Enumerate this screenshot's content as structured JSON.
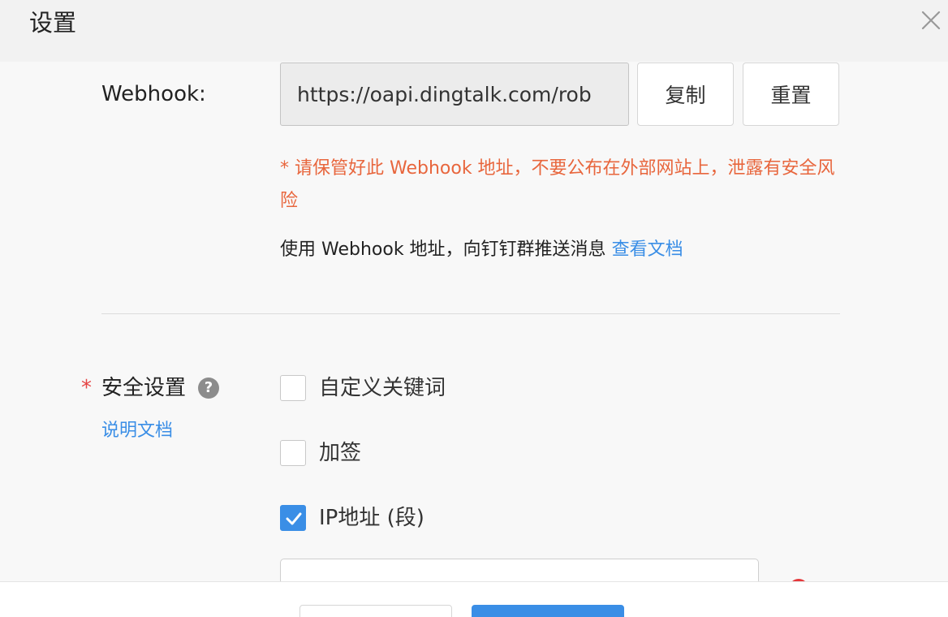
{
  "dialog": {
    "title": "设置"
  },
  "webhook": {
    "label": "Webhook:",
    "value": "https://oapi.dingtalk.com/rob",
    "copy_label": "复制",
    "reset_label": "重置",
    "warning": "* 请保管好此 Webhook 地址，不要公布在外部网站上，泄露有安全风险",
    "usage_text": "使用 Webhook 地址，向钉钉群推送消息",
    "usage_link": "查看文档"
  },
  "security": {
    "required_mark": "*",
    "label": "安全设置",
    "help_glyph": "?",
    "doc_link": "说明文档",
    "options": [
      {
        "label": "自定义关键词",
        "checked": false
      },
      {
        "label": "加签",
        "checked": false
      },
      {
        "label": "IP地址 (段)",
        "checked": true
      }
    ]
  },
  "colors": {
    "accent": "#3a8ee6",
    "warning": "#e8663d",
    "error": "#e5383b"
  },
  "icons": {
    "close": "close-icon",
    "help": "question-circle-icon",
    "check": "check-icon"
  }
}
